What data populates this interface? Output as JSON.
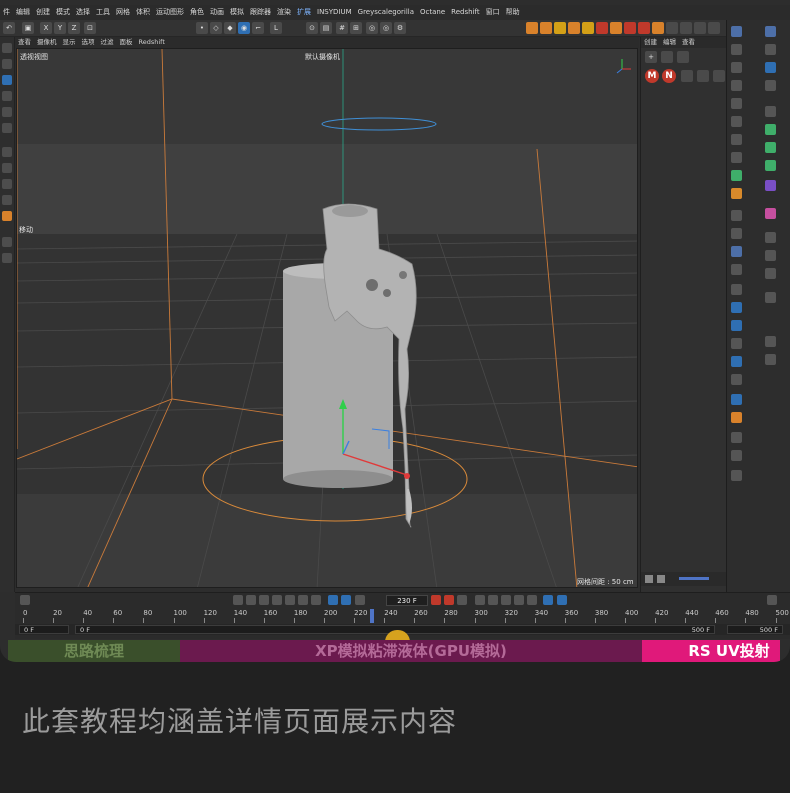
{
  "menubar": {
    "items": [
      "件",
      "编辑",
      "创建",
      "模式",
      "选择",
      "工具",
      "网格",
      "体积",
      "运动图形",
      "角色",
      "动画",
      "模拟",
      "跟踪器",
      "渲染",
      "扩展",
      "INSYDIUM",
      "Greyscalegorilla",
      "Octane",
      "Redshift",
      "窗口",
      "帮助"
    ]
  },
  "viewport_menu": {
    "items": [
      "查看",
      "摄像机",
      "显示",
      "选项",
      "过滤",
      "面板",
      "Redshift"
    ]
  },
  "viewport": {
    "name": "透视视图",
    "camera": "默认摄像机",
    "move_label": "移动",
    "grid_spacing": "网格间距 : 50 cm"
  },
  "object_panel": {
    "menu": [
      "创建",
      "编辑",
      "查看"
    ],
    "badges": [
      "M",
      "N"
    ]
  },
  "timeline": {
    "current_frame": "230 F",
    "ticks": [
      "0",
      "20",
      "40",
      "60",
      "80",
      "100",
      "120",
      "140",
      "160",
      "180",
      "200",
      "220",
      "240",
      "260",
      "280",
      "300",
      "320",
      "340",
      "360",
      "380",
      "400",
      "420",
      "440",
      "460",
      "480",
      "500"
    ],
    "start_box": "0 F",
    "start_box2": "0 F",
    "end_box": "500 F",
    "end_box2": "500 F"
  },
  "banner": {
    "seg1": "思路梳理",
    "seg2": "XP模拟粘滞液体(GPU模拟)",
    "seg3": "RS  UV投射"
  },
  "caption": "此套教程均涵盖详情页面展示内容",
  "colors": {
    "accent": "#d9822b",
    "banner_green": "#3a4f2b",
    "banner_purple": "#6b1a4e",
    "banner_pink": "#e0197a",
    "caption": "#9b9b9b"
  }
}
